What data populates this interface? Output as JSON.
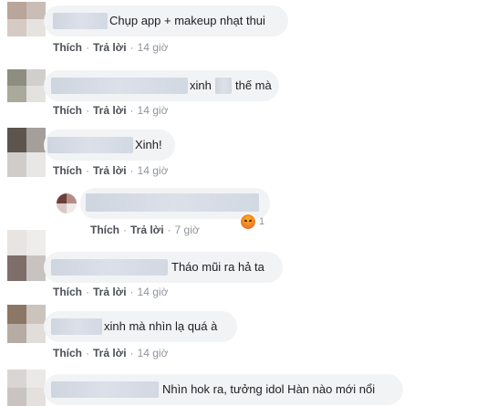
{
  "actions": {
    "like": "Thích",
    "reply": "Trả lời",
    "sep": "·"
  },
  "comments": [
    {
      "text": "Chụp app + makeup nhạt thui",
      "time": "14 giờ"
    },
    {
      "text_a": "xinh",
      "text_b": "thế mà",
      "time": "14 giờ"
    },
    {
      "text": "Xinh!",
      "time": "14 giờ"
    },
    {
      "text": "",
      "time": "7 giờ",
      "reaction_count": "1",
      "reaction_icon": "angry-reaction-icon"
    },
    {
      "text": "Tháo mũi ra hả ta",
      "time": "14 giờ"
    },
    {
      "text": "xinh mà nhìn lạ quá à",
      "time": "14 giờ"
    },
    {
      "text": "Nhìn hok ra, tưởng idol Hàn nào mới nổi"
    }
  ]
}
